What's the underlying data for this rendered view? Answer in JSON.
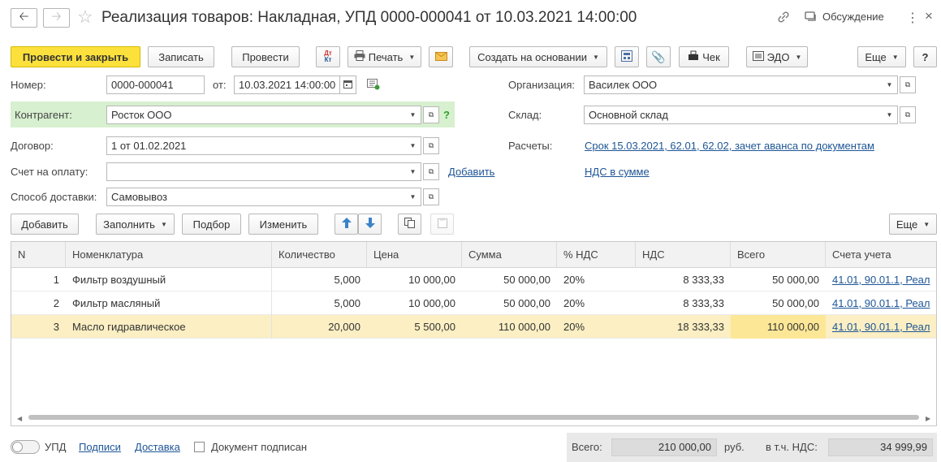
{
  "window": {
    "title": "Реализация товаров: Накладная, УПД 0000-000041 от 10.03.2021 14:00:00",
    "discussion_label": "Обсуждение"
  },
  "toolbar": {
    "post_and_close": "Провести и закрыть",
    "save": "Записать",
    "post": "Провести",
    "dt_kt_icon": "Дт Кт",
    "print": "Печать",
    "create_based_on": "Создать на основании",
    "receipt": "Чек",
    "edo": "ЭДО",
    "more": "Еще",
    "help": "?"
  },
  "form": {
    "number_label": "Номер:",
    "number_value": "0000-000041",
    "date_label": "от:",
    "date_value": "10.03.2021 14:00:00",
    "counterparty_label": "Контрагент:",
    "counterparty_value": "Росток ООО",
    "contract_label": "Договор:",
    "contract_value": "1 от 01.02.2021",
    "invoice_label": "Счет на оплату:",
    "invoice_value": "",
    "add_link": "Добавить",
    "delivery_label": "Способ доставки:",
    "delivery_value": "Самовывоз",
    "org_label": "Организация:",
    "org_value": "Василек ООО",
    "warehouse_label": "Склад:",
    "warehouse_value": "Основной склад",
    "settlements_label": "Расчеты:",
    "settlements_link": "Срок 15.03.2021, 62.01, 62.02, зачет аванса по документам",
    "vat_link": "НДС в сумме"
  },
  "table_toolbar": {
    "add": "Добавить",
    "fill": "Заполнить",
    "select": "Подбор",
    "change": "Изменить",
    "more": "Еще"
  },
  "table": {
    "headers": [
      "N",
      "Номенклатура",
      "Количество",
      "Цена",
      "Сумма",
      "% НДС",
      "НДС",
      "Всего",
      "Счета учета"
    ],
    "rows": [
      {
        "n": "1",
        "name": "Фильтр воздушный",
        "qty": "5,000",
        "price": "10 000,00",
        "sum": "50 000,00",
        "vat_rate": "20%",
        "vat": "8 333,33",
        "total": "50 000,00",
        "accounts": "41.01, 90.01.1, Реал"
      },
      {
        "n": "2",
        "name": "Фильтр масляный",
        "qty": "5,000",
        "price": "10 000,00",
        "sum": "50 000,00",
        "vat_rate": "20%",
        "vat": "8 333,33",
        "total": "50 000,00",
        "accounts": "41.01, 90.01.1, Реал"
      },
      {
        "n": "3",
        "name": "Масло гидравлическое",
        "qty": "20,000",
        "price": "5 500,00",
        "sum": "110 000,00",
        "vat_rate": "20%",
        "vat": "18 333,33",
        "total": "110 000,00",
        "accounts": "41.01, 90.01.1, Реал"
      }
    ]
  },
  "footer": {
    "upd_label": "УПД",
    "signatures_link": "Подписи",
    "delivery_link": "Доставка",
    "signed_label": "Документ подписан",
    "total_label": "Всего:",
    "total_value": "210 000,00",
    "currency": "руб.",
    "vat_label": "в т.ч. НДС:",
    "vat_value": "34 999,99"
  },
  "colors": {
    "primary_button": "#fce13c",
    "link": "#1d5596",
    "selected_row": "#fbefc3",
    "counterparty_highlight": "#d7f0cf"
  }
}
